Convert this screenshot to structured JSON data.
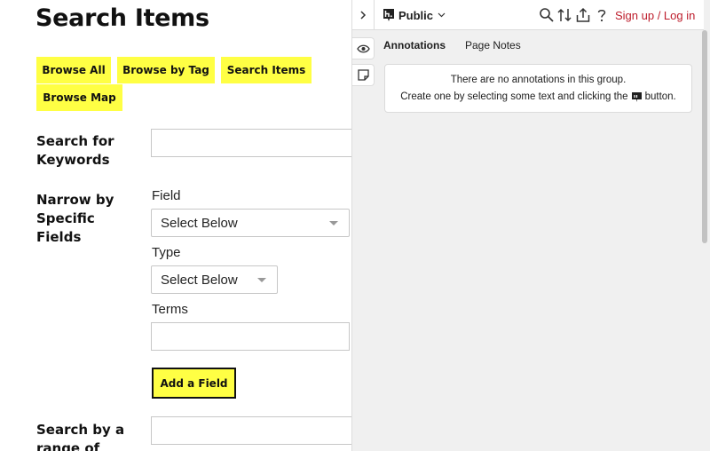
{
  "page": {
    "title": "Search Items",
    "nav": [
      "Browse All",
      "Browse by Tag",
      "Search Items",
      "Browse Map"
    ],
    "keyword_label": "Search for Keywords",
    "keyword_value": "",
    "narrow_label": "Narrow by Specific Fields",
    "field_label": "Field",
    "field_select": "Select Below",
    "type_label": "Type",
    "type_select": "Select Below",
    "terms_label": "Terms",
    "terms_value": "",
    "add_field": "Add a Field",
    "range_label": "Search by a range of",
    "range_value": "",
    "accent_color": "#ffff44"
  },
  "sidebar": {
    "group": "Public",
    "login": "Sign up / Log in",
    "tabs": [
      "Annotations",
      "Page Notes"
    ],
    "active_tab": "Annotations",
    "empty_line1": "There are no annotations in this group.",
    "empty_line2_pre": "Create one by selecting some text and clicking the",
    "empty_line2_post": "button.",
    "icons": [
      "chevron-right-icon",
      "hypothesis-logo-icon",
      "chevron-down-icon",
      "search-icon",
      "sort-icon",
      "share-icon",
      "help-icon",
      "eye-icon",
      "note-icon",
      "annotate-icon"
    ],
    "login_color": "#bd1c2b"
  }
}
